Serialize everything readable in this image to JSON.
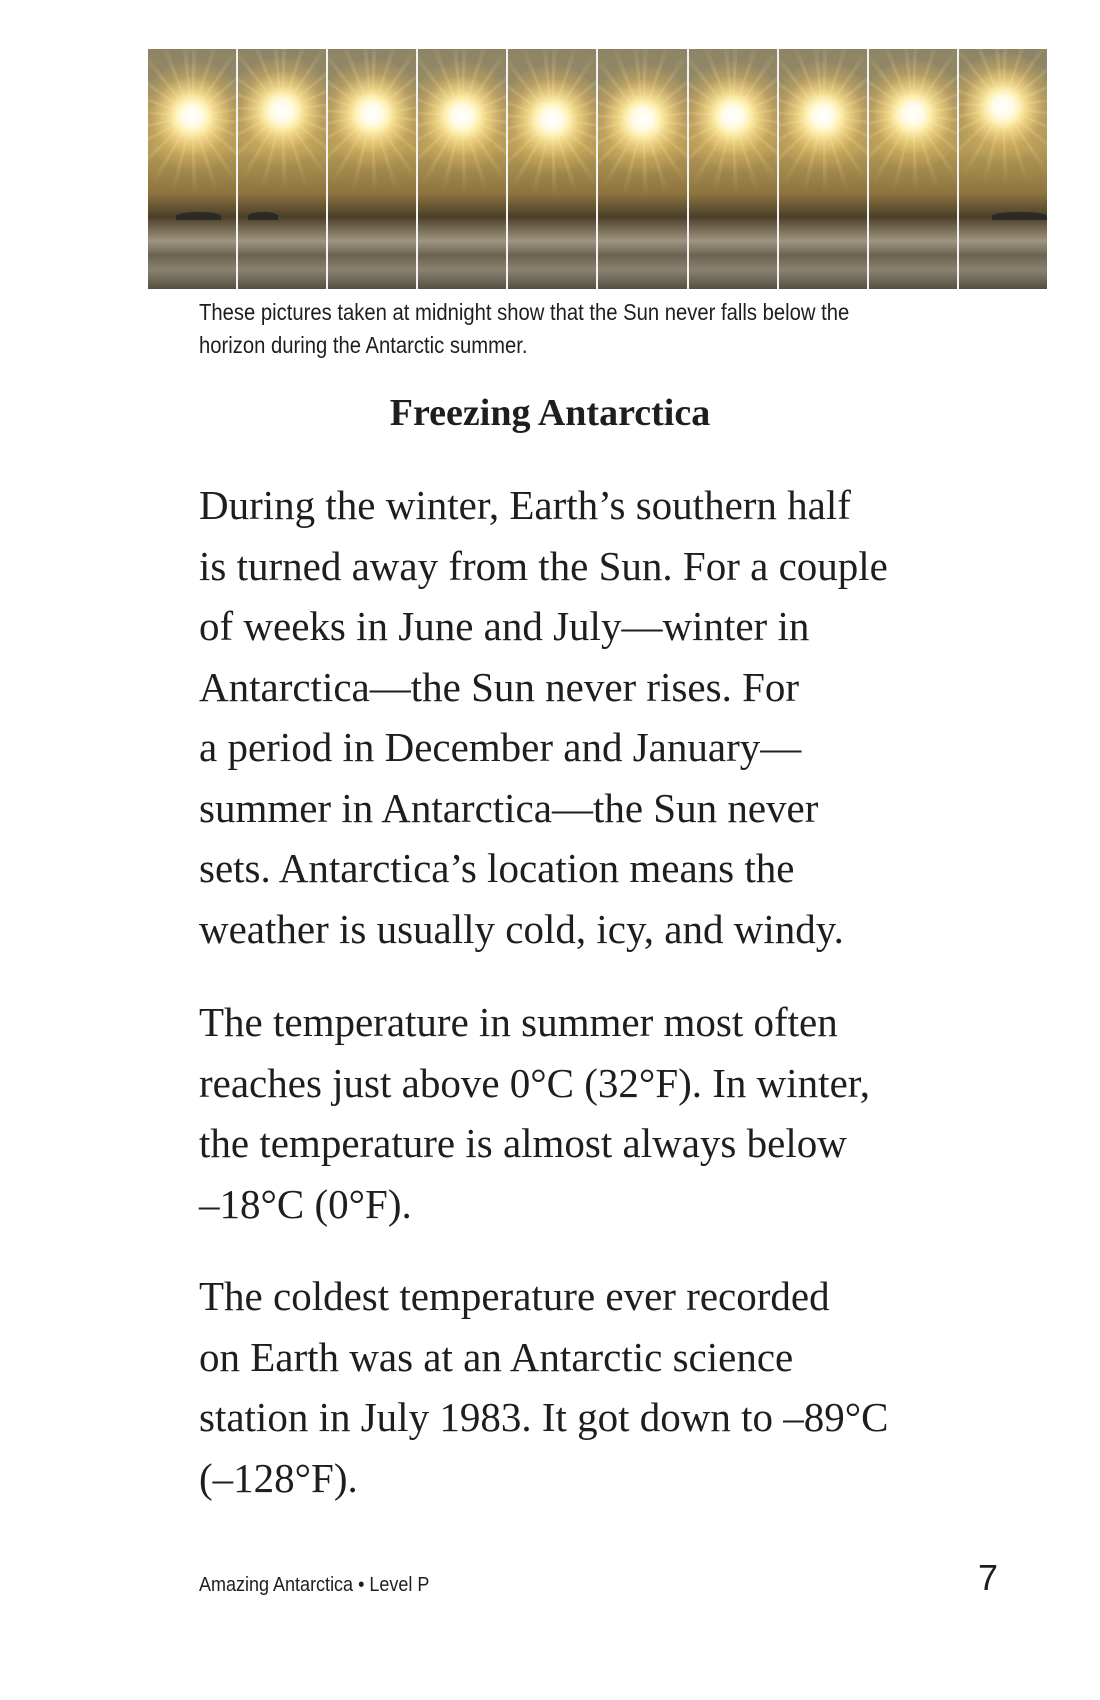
{
  "photo": {
    "description_icon": "midnight-sun-sequence-photo",
    "frame_count": 10,
    "sun_heights": [
      0.28,
      0.26,
      0.27,
      0.28,
      0.29,
      0.29,
      0.28,
      0.28,
      0.27,
      0.24
    ]
  },
  "caption": {
    "lines": [
      "These pictures taken at midnight show that the Sun never falls below the",
      "horizon during the Antarctic summer."
    ]
  },
  "heading": "Freezing Antarctica",
  "paragraphs": [
    {
      "lines": [
        "During the winter, Earth’s southern half",
        "is turned away from the Sun. For a couple",
        "of weeks in June and July—winter in",
        "Antarctica—the Sun never rises. For",
        "a period in December and January—",
        "summer in Antarctica—the Sun never",
        "sets. Antarctica’s location means the",
        "weather is usually cold, icy, and windy."
      ]
    },
    {
      "lines": [
        "The temperature in summer most often",
        "reaches just above 0°C (32°F). In winter,",
        "the temperature is almost always below",
        "–18°C (0°F)."
      ]
    },
    {
      "lines": [
        "The coldest temperature ever recorded",
        "on Earth was at an Antarctic science",
        "station in July 1983. It got down to –89°C",
        "(–128°F)."
      ]
    }
  ],
  "footer": {
    "book_title": "Amazing Antarctica • Level P",
    "page_number": "7"
  }
}
